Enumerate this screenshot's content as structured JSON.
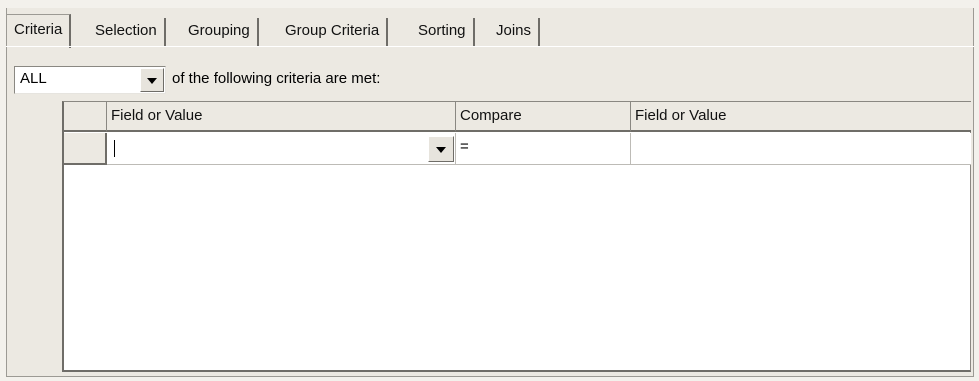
{
  "tabs": [
    {
      "label": "Criteria",
      "active": true
    },
    {
      "label": "Selection",
      "active": false
    },
    {
      "label": "Grouping",
      "active": false
    },
    {
      "label": "Group Criteria",
      "active": false
    },
    {
      "label": "Sorting",
      "active": false
    },
    {
      "label": "Joins",
      "active": false
    }
  ],
  "match": {
    "selected": "ALL",
    "suffix_text": "of the following criteria are met:"
  },
  "grid": {
    "columns": [
      "Field or Value",
      "Compare",
      "Field or Value"
    ],
    "rows": [
      {
        "field": "",
        "compare": "=",
        "value": ""
      }
    ]
  }
}
